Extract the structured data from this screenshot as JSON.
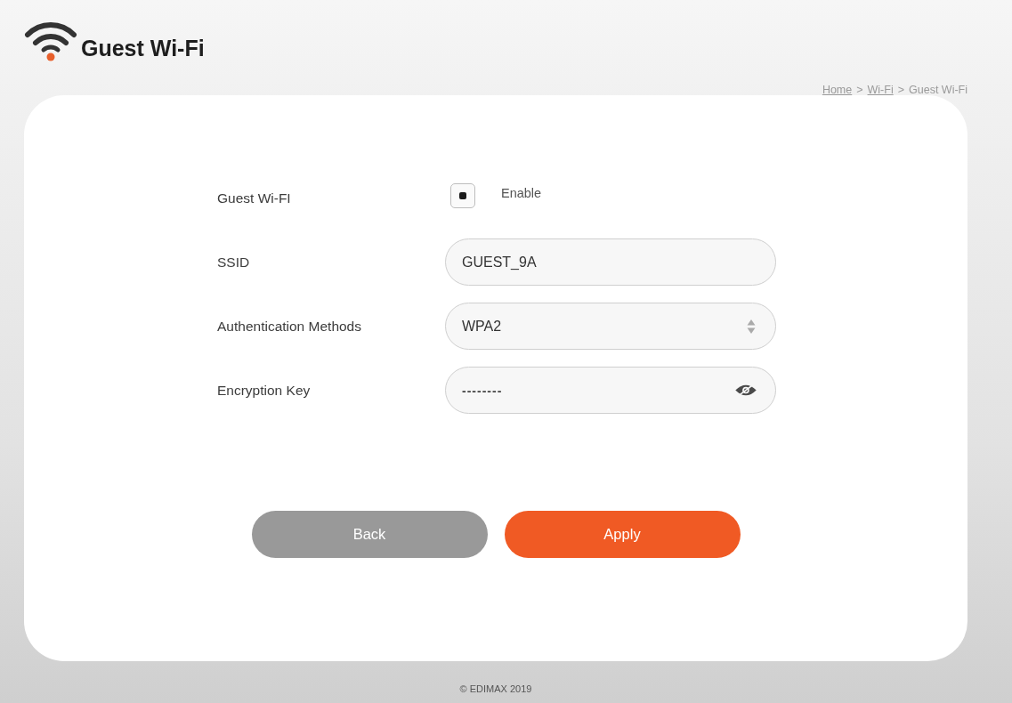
{
  "header": {
    "title": "Guest Wi-Fi",
    "breadcrumb": {
      "separator": ">",
      "items": [
        {
          "label": "Home",
          "link": true
        },
        {
          "label": "Wi-Fi",
          "link": true
        },
        {
          "label": "Guest Wi-Fi",
          "link": false
        }
      ]
    }
  },
  "form": {
    "rows": [
      {
        "kind": "checkbox",
        "label": "Guest Wi-FI",
        "option": "Enable",
        "checked": true
      },
      {
        "kind": "text",
        "label": "SSID",
        "value": "GUEST_9A"
      },
      {
        "kind": "select",
        "label": "Authentication Methods",
        "value": "WPA2"
      },
      {
        "kind": "password",
        "label": "Encryption Key",
        "value": "--------"
      }
    ]
  },
  "buttons": [
    {
      "label": "Back",
      "kind": "secondary"
    },
    {
      "label": "Apply",
      "kind": "primary"
    }
  ],
  "footer": {
    "copyright": "© EDIMAX 2019"
  }
}
